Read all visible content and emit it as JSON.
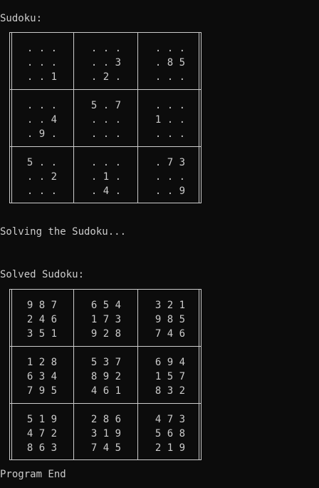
{
  "console": {
    "sudoku_label": "Sudoku:",
    "solving_label": "Solving the Sudoku...",
    "solved_label": "Solved Sudoku:",
    "end_label": "Program End"
  },
  "puzzle": {
    "boxes": [
      [
        ". . .",
        ". . .",
        ". . 1"
      ],
      [
        ". . .",
        ". . 3",
        ". 2 ."
      ],
      [
        ". . .",
        ". 8 5",
        ". . ."
      ],
      [
        ". . .",
        ". . 4",
        ". 9 ."
      ],
      [
        "5 . 7",
        ". . .",
        ". . ."
      ],
      [
        ". . .",
        "1 . .",
        ". . ."
      ],
      [
        "5 . .",
        ". . 2",
        ". . ."
      ],
      [
        ". . .",
        ". 1 .",
        ". 4 ."
      ],
      [
        ". 7 3",
        ". . .",
        ". . 9"
      ]
    ]
  },
  "solution": {
    "boxes": [
      [
        "9 8 7",
        "2 4 6",
        "3 5 1"
      ],
      [
        "6 5 4",
        "1 7 3",
        "9 2 8"
      ],
      [
        "3 2 1",
        "9 8 5",
        "7 4 6"
      ],
      [
        "1 2 8",
        "6 3 4",
        "7 9 5"
      ],
      [
        "5 3 7",
        "8 9 2",
        "4 6 1"
      ],
      [
        "6 9 4",
        "1 5 7",
        "8 3 2"
      ],
      [
        "5 1 9",
        "4 7 2",
        "8 6 3"
      ],
      [
        "2 8 6",
        "3 1 9",
        "7 4 5"
      ],
      [
        "4 7 3",
        "5 6 8",
        "2 1 9"
      ]
    ]
  },
  "colors": {
    "background": "#0c0c0c",
    "text": "#cccccc"
  }
}
